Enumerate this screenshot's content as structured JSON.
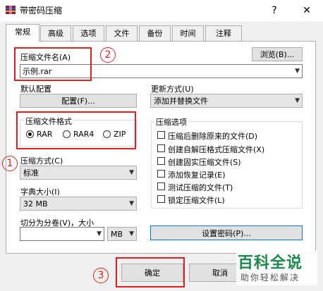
{
  "window": {
    "title": "带密码压缩",
    "help_glyph": "?",
    "close_glyph": "✕"
  },
  "tabs": [
    {
      "label": "常规"
    },
    {
      "label": "高级"
    },
    {
      "label": "选项"
    },
    {
      "label": "文件"
    },
    {
      "label": "备份"
    },
    {
      "label": "时间"
    },
    {
      "label": "注释"
    }
  ],
  "archive": {
    "label": "压缩文件名(A)",
    "browse_label": "浏览(B)...",
    "filename_value": "示例.rar"
  },
  "profile": {
    "label": "默认配置",
    "button_label": "配置(F)..."
  },
  "update": {
    "label": "更新方式(U)",
    "value": "添加并替换文件"
  },
  "format": {
    "title": "压缩文件格式",
    "options": [
      {
        "label": "RAR",
        "checked": true
      },
      {
        "label": "RAR4",
        "checked": false
      },
      {
        "label": "ZIP",
        "checked": false
      }
    ]
  },
  "method": {
    "label": "压缩方式(C)",
    "value": "标准"
  },
  "dictionary": {
    "label": "字典大小(I)",
    "value": "32 MB"
  },
  "split": {
    "label": "切分为分卷(V)，大小",
    "value": "",
    "unit": "MB"
  },
  "options": {
    "title": "压缩选项",
    "items": [
      {
        "label": "压缩后删除原来的文件(D)",
        "checked": false
      },
      {
        "label": "创建自解压格式压缩文件(X)",
        "checked": false
      },
      {
        "label": "创建固实压缩文件(S)",
        "checked": false
      },
      {
        "label": "添加恢复记录(E)",
        "checked": false
      },
      {
        "label": "测试压缩的文件(T)",
        "checked": false
      },
      {
        "label": "锁定压缩文件(L)",
        "checked": false
      }
    ]
  },
  "password_button_label": "设置密码(P)...",
  "footer": {
    "ok_label": "确定",
    "cancel_label": "取消"
  },
  "annotations": {
    "step1": "1",
    "step2": "2",
    "step3": "3",
    "highlight_color": "#e02020"
  },
  "watermark": {
    "title": "百科全说",
    "subtitle": "助你轻松解决"
  }
}
